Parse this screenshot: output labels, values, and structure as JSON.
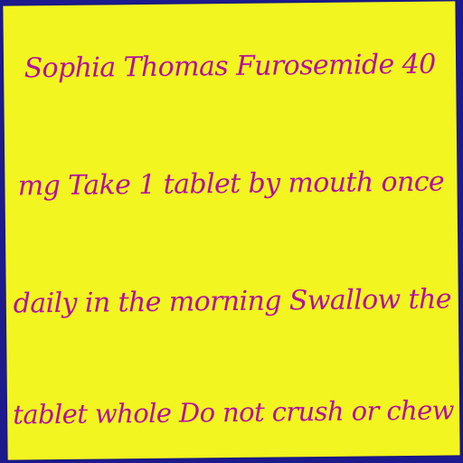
{
  "note": {
    "lines": [
      "Sophia Thomas Furosemide 40",
      "mg Take 1 tablet by mouth once",
      "daily in the morning Swallow the",
      "tablet whole Do not crush or chew"
    ]
  },
  "colors": {
    "background": "#1c1a8c",
    "paper": "#f2f51f",
    "ink": "#b40fa0"
  }
}
